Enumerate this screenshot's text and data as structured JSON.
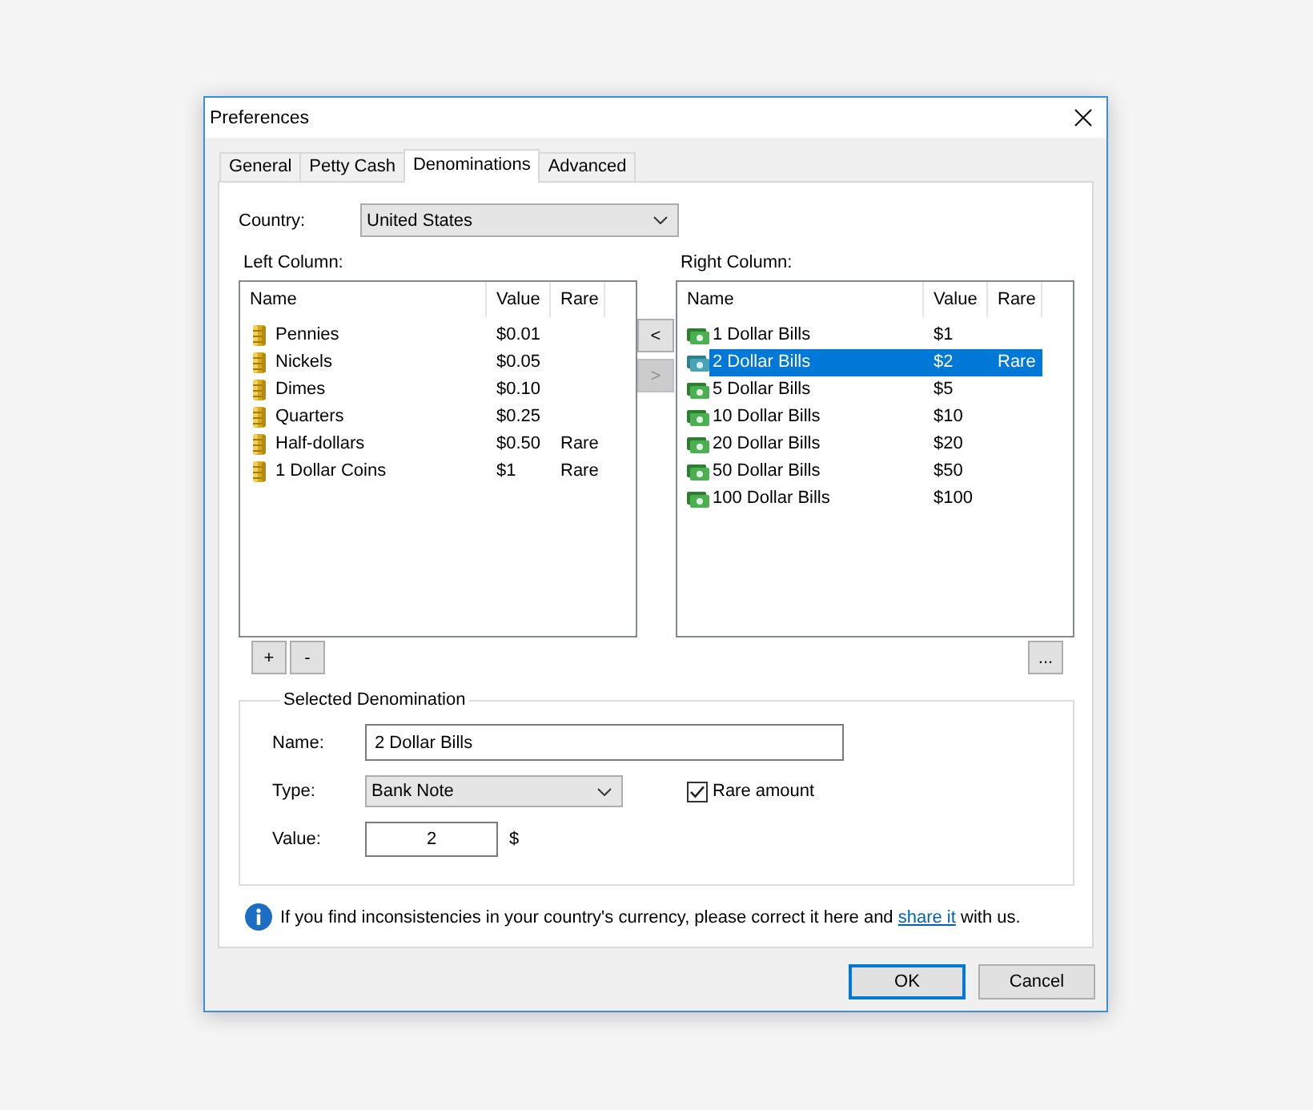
{
  "window": {
    "title": "Preferences"
  },
  "tabs": [
    {
      "label": "General",
      "selected": false
    },
    {
      "label": "Petty Cash",
      "selected": false
    },
    {
      "label": "Denominations",
      "selected": true
    },
    {
      "label": "Advanced",
      "selected": false
    }
  ],
  "country": {
    "label": "Country:",
    "value": "United States"
  },
  "left_column": {
    "label": "Left Column:",
    "columns": [
      "Name",
      "Value",
      "Rare"
    ],
    "rows": [
      {
        "name": "Pennies",
        "value": "$0.01",
        "selected": false
      },
      {
        "name": "Nickels",
        "value": "$0.05",
        "selected": false
      },
      {
        "name": "Dimes",
        "value": "$0.10",
        "selected": false
      },
      {
        "name": "Quarters",
        "value": "$0.25",
        "selected": false
      },
      {
        "name": "Half-dollars",
        "value": "$0.50",
        "rare": "Rare",
        "selected": false
      },
      {
        "name": "1 Dollar Coins",
        "value": "$1",
        "rare": "Rare",
        "selected": false
      }
    ],
    "buttons": [
      "+",
      "-"
    ]
  },
  "move_buttons": [
    {
      "label": "<",
      "disabled": false
    },
    {
      "label": ">",
      "disabled": true
    }
  ],
  "right_column": {
    "label": "Right Column:",
    "columns": [
      "Name",
      "Value",
      "Rare"
    ],
    "rows": [
      {
        "name": "1 Dollar Bills",
        "value": "$1",
        "selected": false
      },
      {
        "name": "2 Dollar Bills",
        "value": "$2",
        "rare": "Rare",
        "selected": true
      },
      {
        "name": "5 Dollar Bills",
        "value": "$5",
        "selected": false
      },
      {
        "name": "10 Dollar Bills",
        "value": "$10",
        "selected": false
      },
      {
        "name": "20 Dollar Bills",
        "value": "$20",
        "selected": false
      },
      {
        "name": "50 Dollar Bills",
        "value": "$50",
        "selected": false
      },
      {
        "name": "100 Dollar Bills",
        "value": "$100",
        "selected": false
      }
    ],
    "buttons": [
      "..."
    ]
  },
  "selected_denomination": {
    "title": "Selected Denomination",
    "name": {
      "label": "Name:",
      "value": "2 Dollar Bills"
    },
    "type": {
      "label": "Type:",
      "value": "Bank Note"
    },
    "rare": {
      "label": "Rare amount",
      "checked": true
    },
    "value": {
      "label": "Value:",
      "value": "2",
      "unit": "$"
    }
  },
  "info": {
    "text": "If you find inconsistencies in your country's currency, please correct it here and",
    "link": "share it",
    "text_end": "with us."
  },
  "dialog_buttons": [
    {
      "label": "OK",
      "default": true
    },
    {
      "label": "Cancel",
      "default": false
    }
  ]
}
